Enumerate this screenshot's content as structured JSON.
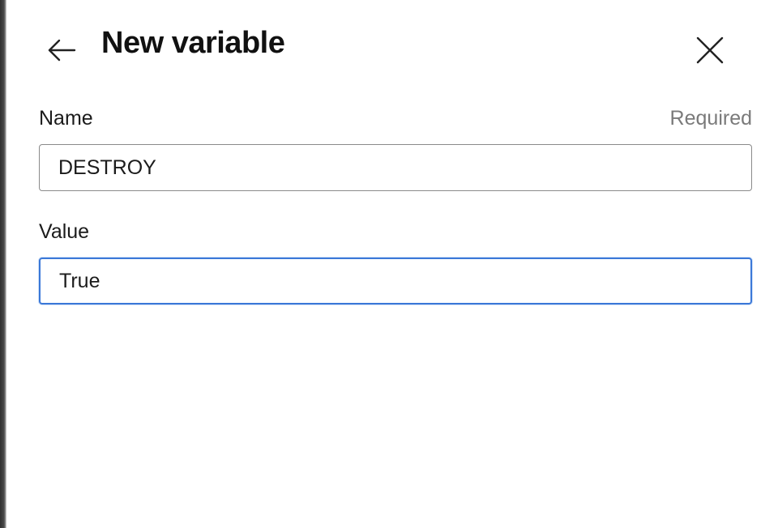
{
  "dialog": {
    "title": "New variable",
    "back_icon": "arrow-left-icon",
    "close_icon": "close-icon"
  },
  "fields": {
    "name": {
      "label": "Name",
      "required_text": "Required",
      "value": "DESTROY"
    },
    "value": {
      "label": "Value",
      "value": "True",
      "focused": true
    }
  },
  "colors": {
    "focus_border": "#3b78d8",
    "input_border": "#8a8a8a",
    "required_text": "#7a7a7a"
  }
}
